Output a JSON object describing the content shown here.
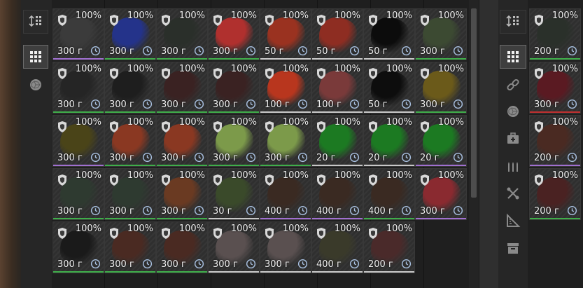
{
  "left_toolbar": {
    "buttons": [
      {
        "name": "sort-button",
        "icon": "sort-icon",
        "active": false
      },
      {
        "name": "grid-view-button",
        "icon": "grid-icon",
        "active": true
      },
      {
        "name": "materials-filter-button",
        "icon": "ore-icon",
        "active": false
      }
    ]
  },
  "right_toolbar": {
    "buttons": [
      {
        "name": "sort-button",
        "icon": "sort-icon",
        "active": false
      },
      {
        "name": "grid-view-button",
        "icon": "grid-icon",
        "active": true
      },
      {
        "name": "chain-filter-button",
        "icon": "chain-icon",
        "active": false
      },
      {
        "name": "materials-filter-button",
        "icon": "ore-icon",
        "active": false
      },
      {
        "name": "medical-filter-button",
        "icon": "medkit-icon",
        "active": false
      },
      {
        "name": "ammo-filter-button",
        "icon": "ammo-icon",
        "active": false
      },
      {
        "name": "tools-filter-button",
        "icon": "tools-icon",
        "active": false
      },
      {
        "name": "ruler-filter-button",
        "icon": "ruler-icon",
        "active": false
      },
      {
        "name": "storage-filter-button",
        "icon": "box-icon",
        "active": false
      }
    ]
  },
  "colors": {
    "rarity_purple": "#a070d0",
    "rarity_green": "#3fae4a",
    "rarity_white": "#c8c8c8",
    "rarity_red": "#c03030"
  },
  "left_grid": [
    [
      {
        "percent": "100%",
        "price": "300 г",
        "color": "#3b3b3b",
        "rarity": "#a070d0"
      },
      {
        "percent": "100%",
        "price": "300 г",
        "color": "#24338a",
        "rarity": "#3fae4a"
      },
      {
        "percent": "100%",
        "price": "300 г",
        "color": "#2a2f2a",
        "rarity": "#3fae4a"
      },
      {
        "percent": "100%",
        "price": "300 г",
        "color": "#b0302e",
        "rarity": "#3fae4a"
      },
      {
        "percent": "100%",
        "price": "50 г",
        "color": "#9a3220",
        "rarity": "#c8c8c8"
      },
      {
        "percent": "100%",
        "price": "50 г",
        "color": "#8e2d22",
        "rarity": "#c8c8c8"
      },
      {
        "percent": "100%",
        "price": "50 г",
        "color": "#0c0c0c",
        "rarity": "#c8c8c8"
      },
      {
        "percent": "100%",
        "price": "300 г",
        "color": "#3c4a32",
        "rarity": "#3fae4a"
      }
    ],
    [
      {
        "percent": "100%",
        "price": "300 г",
        "color": "#252525",
        "rarity": "#3fae4a"
      },
      {
        "percent": "100%",
        "price": "300 г",
        "color": "#1e1e1e",
        "rarity": "#3fae4a"
      },
      {
        "percent": "100%",
        "price": "300 г",
        "color": "#3a2222",
        "rarity": "#3fae4a"
      },
      {
        "percent": "100%",
        "price": "300 г",
        "color": "#3a2222",
        "rarity": "#3fae4a"
      },
      {
        "percent": "100%",
        "price": "100 г",
        "color": "#b8361e",
        "rarity": "#c8c8c8"
      },
      {
        "percent": "100%",
        "price": "100 г",
        "color": "#7a3a3a",
        "rarity": "#c8c8c8"
      },
      {
        "percent": "100%",
        "price": "50 г",
        "color": "#0d0d0d",
        "rarity": "#c8c8c8"
      },
      {
        "percent": "100%",
        "price": "300 г",
        "color": "#6b5a1a",
        "rarity": "#3fae4a"
      }
    ],
    [
      {
        "percent": "100%",
        "price": "300 г",
        "color": "#4a4418",
        "rarity": "#a070d0"
      },
      {
        "percent": "100%",
        "price": "300 г",
        "color": "#8a3822",
        "rarity": "#3fae4a"
      },
      {
        "percent": "100%",
        "price": "300 г",
        "color": "#8a3822",
        "rarity": "#3fae4a"
      },
      {
        "percent": "100%",
        "price": "300 г",
        "color": "#7c9a4a",
        "rarity": "#3fae4a"
      },
      {
        "percent": "100%",
        "price": "300 г",
        "color": "#7c9a4a",
        "rarity": "#3fae4a"
      },
      {
        "percent": "100%",
        "price": "20 г",
        "color": "#1c7a22",
        "rarity": "#c8c8c8"
      },
      {
        "percent": "100%",
        "price": "20 г",
        "color": "#1c7a22",
        "rarity": "#c8c8c8"
      },
      {
        "percent": "100%",
        "price": "20 г",
        "color": "#1c7a22",
        "rarity": "#a070d0"
      }
    ],
    [
      {
        "percent": "100%",
        "price": "300 г",
        "color": "#2e3a30",
        "rarity": "#3fae4a"
      },
      {
        "percent": "100%",
        "price": "300 г",
        "color": "#2e3a30",
        "rarity": "#3fae4a"
      },
      {
        "percent": "100%",
        "price": "300 г",
        "color": "#6a3a22",
        "rarity": "#3fae4a"
      },
      {
        "percent": "100%",
        "price": "30 г",
        "color": "#3a4a2a",
        "rarity": "#c8c8c8"
      },
      {
        "percent": "100%",
        "price": "400 г",
        "color": "#3a2a22",
        "rarity": "#a070d0"
      },
      {
        "percent": "100%",
        "price": "400 г",
        "color": "#3a2a22",
        "rarity": "#a070d0"
      },
      {
        "percent": "100%",
        "price": "400 г",
        "color": "#3a2a22",
        "rarity": "#3fae4a"
      },
      {
        "percent": "100%",
        "price": "300 г",
        "color": "#8a2a30",
        "rarity": "#a070d0"
      }
    ],
    [
      {
        "percent": "100%",
        "price": "300 г",
        "color": "#1a1a1a",
        "rarity": "#3fae4a"
      },
      {
        "percent": "100%",
        "price": "300 г",
        "color": "#4a2a22",
        "rarity": "#3fae4a"
      },
      {
        "percent": "100%",
        "price": "300 г",
        "color": "#4a2a22",
        "rarity": "#3fae4a"
      },
      {
        "percent": "100%",
        "price": "300 г",
        "color": "#5a5050",
        "rarity": "#c8c8c8"
      },
      {
        "percent": "100%",
        "price": "300 г",
        "color": "#5a5050",
        "rarity": "#c8c8c8"
      },
      {
        "percent": "100%",
        "price": "400 г",
        "color": "#3a3a2a",
        "rarity": "#c8c8c8"
      },
      {
        "percent": "100%",
        "price": "200 г",
        "color": "#4a2a2a",
        "rarity": "#c8c8c8"
      }
    ]
  ],
  "right_grid": [
    {
      "percent": "100%",
      "price": "200 г",
      "color": "#2a302a",
      "rarity": "#3fae4a"
    },
    {
      "percent": "100%",
      "price": "300 г",
      "color": "#5a1a22",
      "rarity": "#c03030"
    },
    {
      "percent": "100%",
      "price": "200 г",
      "color": "#4a2a22",
      "rarity": "#a070d0"
    },
    {
      "percent": "100%",
      "price": "200 г",
      "color": "#4a2222",
      "rarity": "#3fae4a"
    }
  ]
}
